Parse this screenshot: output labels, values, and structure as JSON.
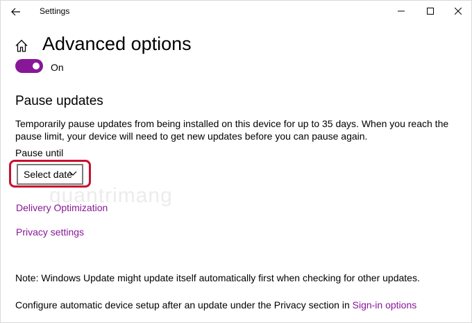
{
  "window": {
    "title": "Settings"
  },
  "page": {
    "title": "Advanced options",
    "toggle_state": "On"
  },
  "pause_updates": {
    "heading": "Pause updates",
    "description": "Temporarily pause updates from being installed on this device for up to 35 days. When you reach the pause limit, your device will need to get new updates before you can pause again.",
    "pause_until_label": "Pause until",
    "select_value": "Select date"
  },
  "watermark": "quantrimang",
  "links": {
    "delivery_optimization": "Delivery Optimization",
    "privacy_settings": "Privacy settings",
    "sign_in_options": "Sign-in options"
  },
  "notes": {
    "windows_update_note": "Note: Windows Update might update itself automatically first when checking for other updates.",
    "configure_prefix": "Configure automatic device setup after an update under the Privacy section in "
  },
  "icons": {
    "back": "back-arrow-icon",
    "minimize": "minimize-icon",
    "maximize": "maximize-icon",
    "close": "close-icon",
    "home": "home-icon",
    "chevron": "chevron-down-icon"
  },
  "colors": {
    "accent": "#881798",
    "link": "#881798",
    "highlight": "#c8102e"
  }
}
